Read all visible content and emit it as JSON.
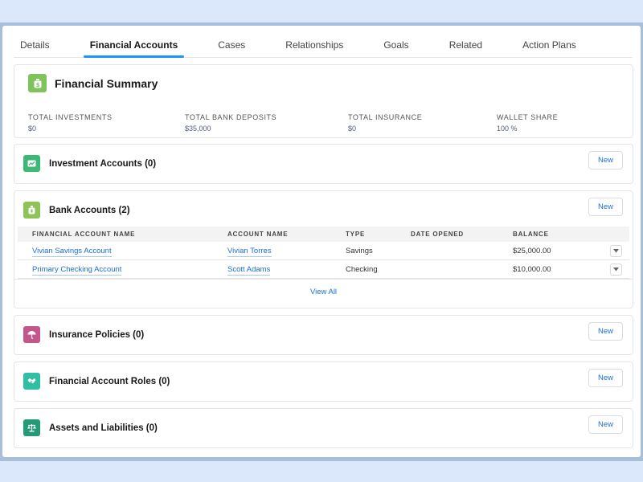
{
  "tabs": [
    {
      "label": "Details",
      "active": false
    },
    {
      "label": "Financial Accounts",
      "active": true
    },
    {
      "label": "Cases",
      "active": false
    },
    {
      "label": "Relationships",
      "active": false
    },
    {
      "label": "Goals",
      "active": false
    },
    {
      "label": "Related",
      "active": false
    },
    {
      "label": "Action Plans",
      "active": false
    }
  ],
  "summary": {
    "title": "Financial Summary",
    "icon": "money-bag-icon",
    "icon_color": "#7fc45a",
    "metrics": [
      {
        "label": "TOTAL INVESTMENTS",
        "value": "$0"
      },
      {
        "label": "TOTAL BANK DEPOSITS",
        "value": "$35,000"
      },
      {
        "label": "TOTAL INSURANCE",
        "value": "$0"
      },
      {
        "label": "WALLET SHARE",
        "value": "100 %"
      }
    ]
  },
  "related_lists": {
    "investment": {
      "title": "Investment Accounts (0)",
      "icon": "investment-chart-icon",
      "icon_color": "#3cb878",
      "new_label": "New"
    },
    "bank": {
      "title": "Bank Accounts (2)",
      "icon": "money-bag-icon",
      "icon_color": "#8ec357",
      "new_label": "New",
      "columns": [
        "FINANCIAL ACCOUNT NAME",
        "ACCOUNT NAME",
        "TYPE",
        "DATE OPENED",
        "BALANCE"
      ],
      "rows": [
        {
          "financial_account_name": "Vivian Savings Account",
          "account_name": "Vivian Torres",
          "type": "Savings",
          "date_opened": "",
          "balance": "$25,000.00"
        },
        {
          "financial_account_name": "Primary Checking Account",
          "account_name": "Scott Adams",
          "type": "Checking",
          "date_opened": "",
          "balance": "$10,000.00"
        }
      ],
      "view_all_label": "View All"
    },
    "insurance": {
      "title": "Insurance Policies (0)",
      "icon": "umbrella-icon",
      "icon_color": "#c5568b",
      "new_label": "New"
    },
    "roles": {
      "title": "Financial Account Roles (0)",
      "icon": "handshake-icon",
      "icon_color": "#2fbfa5",
      "new_label": "New"
    },
    "assets": {
      "title": "Assets and Liabilities (0)",
      "icon": "scales-icon",
      "icon_color": "#229b78",
      "new_label": "New"
    }
  }
}
